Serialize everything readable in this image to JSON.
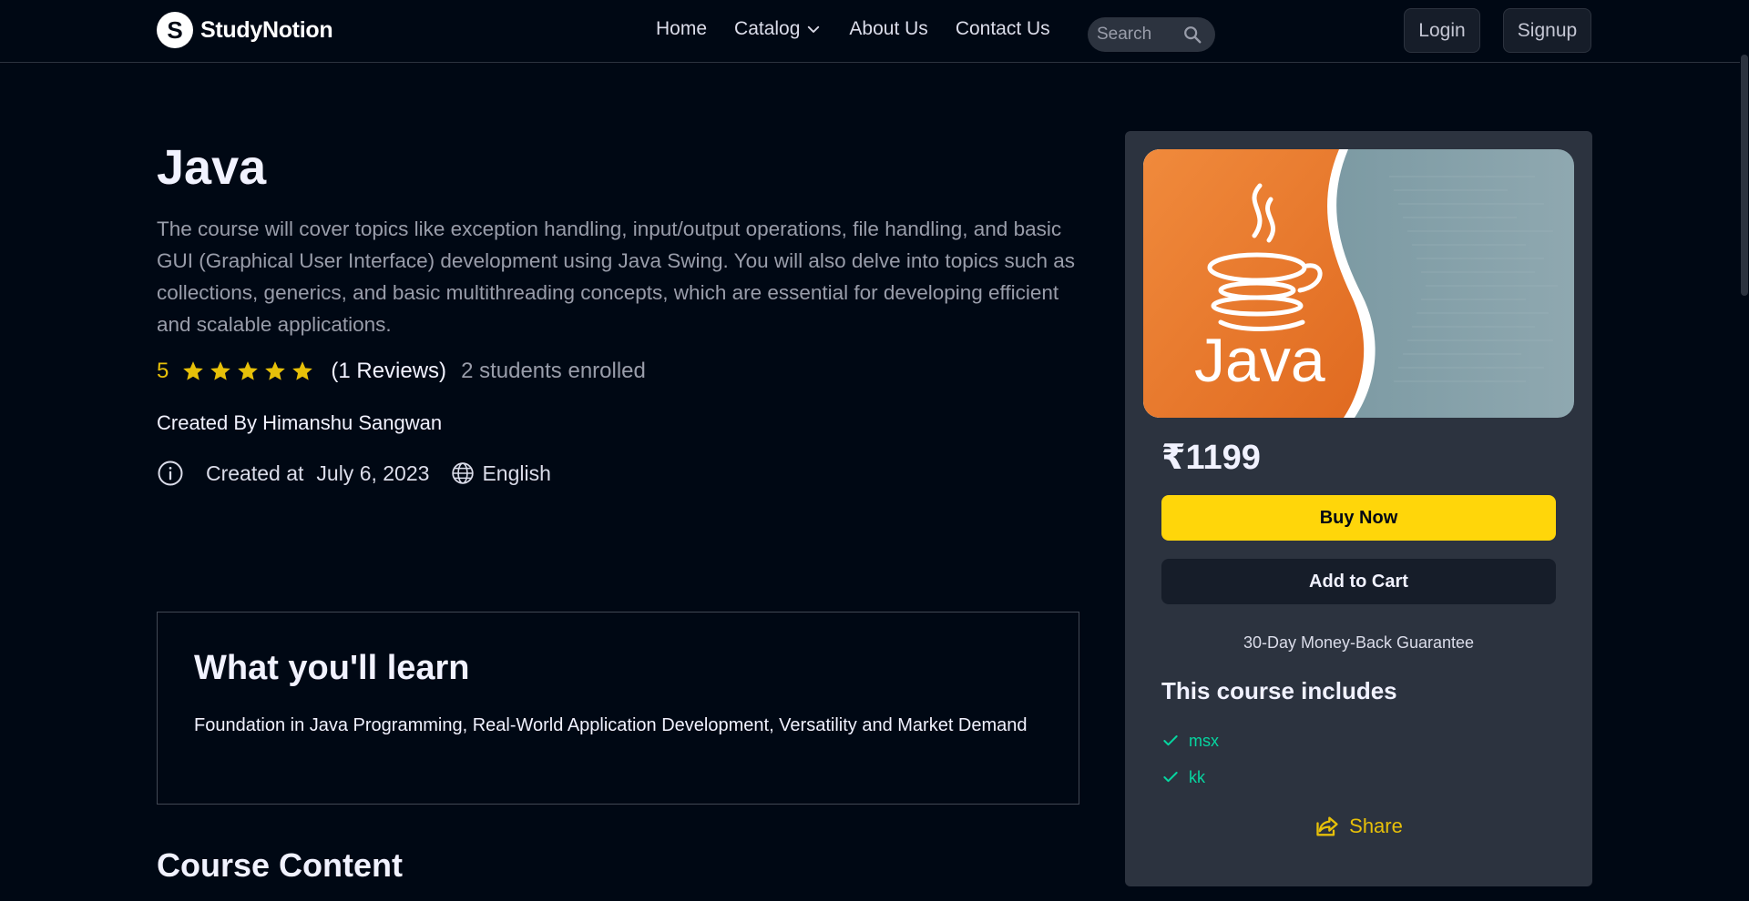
{
  "nav": {
    "brand": "StudyNotion",
    "brand_letter": "S",
    "links": [
      "Home",
      "Catalog",
      "About Us",
      "Contact Us"
    ],
    "search_placeholder": "Search",
    "login": "Login",
    "signup": "Signup"
  },
  "course": {
    "title": "Java",
    "description": "The course will cover topics like exception handling, input/output operations, file handling, and basic GUI (Graphical User Interface) development using Java Swing. You will also delve into topics such as collections, generics, and basic multithreading concepts, which are essential for developing efficient and scalable applications.",
    "rating": "5",
    "rating_value": 5,
    "reviews": "(1 Reviews)",
    "enrolled": "2 students enrolled",
    "created_by": "Created By Himanshu Sangwan",
    "created_label": "Created at",
    "created_date": "July 6, 2023",
    "language": "English"
  },
  "learn": {
    "title": "What you'll learn",
    "text": "Foundation in Java Programming, Real-World Application Development, Versatility and Market Demand"
  },
  "content_title": "Course Content",
  "card": {
    "thumbnail_text": "Java",
    "price": "₹1199",
    "buy_now": "Buy Now",
    "add_to_cart": "Add to Cart",
    "guarantee": "30-Day Money-Back Guarantee",
    "includes_title": "This course includes",
    "includes": [
      "msx",
      "kk"
    ],
    "share": "Share"
  },
  "colors": {
    "background": "#000814",
    "accent_yellow": "#ffd60a",
    "star_yellow": "#e7c009",
    "include_green": "#06d6a0",
    "card_bg": "#2c333f"
  }
}
